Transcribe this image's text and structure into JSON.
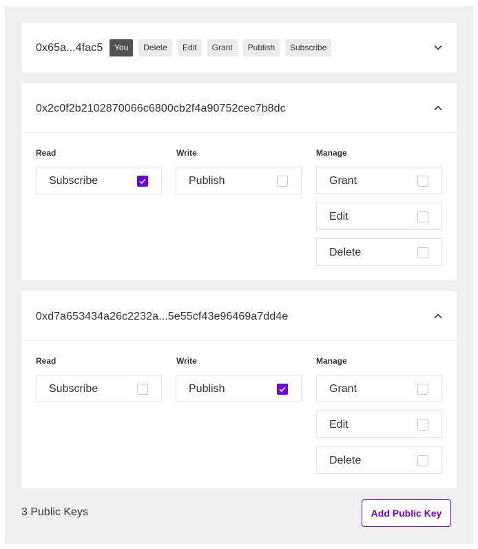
{
  "keys": [
    {
      "address": "0x65a...4fac5",
      "badges": [
        "You",
        "Delete",
        "Edit",
        "Grant",
        "Publish",
        "Subscribe"
      ],
      "expanded": false
    },
    {
      "address": "0x2c0f2b2102870066c6800cb2f4a90752cec7b8dc",
      "expanded": true,
      "columns": {
        "read": "Read",
        "write": "Write",
        "manage": "Manage"
      },
      "permissions": {
        "subscribe": {
          "label": "Subscribe",
          "checked": true
        },
        "publish": {
          "label": "Publish",
          "checked": false
        },
        "grant": {
          "label": "Grant",
          "checked": false
        },
        "edit": {
          "label": "Edit",
          "checked": false
        },
        "delete": {
          "label": "Delete",
          "checked": false
        }
      }
    },
    {
      "address": "0xd7a653434a26c2232a...5e55cf43e96469a7dd4e",
      "expanded": true,
      "columns": {
        "read": "Read",
        "write": "Write",
        "manage": "Manage"
      },
      "permissions": {
        "subscribe": {
          "label": "Subscribe",
          "checked": false
        },
        "publish": {
          "label": "Publish",
          "checked": true
        },
        "grant": {
          "label": "Grant",
          "checked": false
        },
        "edit": {
          "label": "Edit",
          "checked": false
        },
        "delete": {
          "label": "Delete",
          "checked": false
        }
      }
    }
  ],
  "footer": {
    "count_label": "3 Public Keys",
    "add_button_label": "Add Public Key"
  },
  "colors": {
    "accent": "#6b00e6",
    "badge_you": "#525252",
    "badge": "#ececec",
    "background": "#efefef"
  },
  "icons": {
    "collapsed": "chevron-down-icon",
    "expanded": "chevron-up-icon",
    "check": "checkmark-icon"
  }
}
